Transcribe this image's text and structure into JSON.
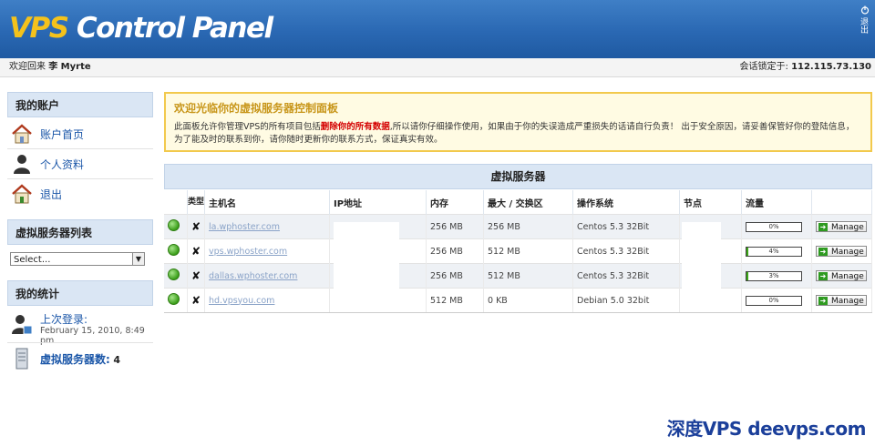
{
  "header": {
    "logo_vps": "VPS",
    "logo_rest": " Control Panel",
    "logout_icon": "power-icon",
    "logout_label": "退出"
  },
  "strip": {
    "welcome_prefix": "欢迎回来",
    "user_name": "李 Myrte",
    "session_label": "会话锁定于:",
    "session_ip": "112.115.73.130"
  },
  "sidebar": {
    "account_heading": "我的账户",
    "items": [
      {
        "label": "账户首页",
        "icon": "home-icon"
      },
      {
        "label": "个人资料",
        "icon": "user-icon"
      },
      {
        "label": "退出",
        "icon": "logout-house-icon"
      }
    ],
    "vs_list_heading": "虚拟服务器列表",
    "select_value": "Select...",
    "stats_heading": "我的统计",
    "last_login_label": "上次登录:",
    "last_login_value": "February 15, 2010, 8:49 pm",
    "vs_count_label": "虚拟服务器数:",
    "vs_count_value": "4"
  },
  "notice": {
    "title": "欢迎光临你的虚拟服务器控制面板",
    "body_before": "此面板允许你管理VPS的所有项目包括",
    "body_warn": "删除你的所有数据",
    "body_after": ",所以请你仔细操作使用，如果由于你的失误造成严重损失的话请自行负责！ 出于安全原因，请妥善保管好你的登陆信息，为了能及时的联系到你，请你随时更新你的联系方式，保证真实有效。"
  },
  "servers": {
    "title": "虚拟服务器",
    "columns": [
      "类型",
      "主机名",
      "IP地址",
      "内存",
      "最大 / 交换区",
      "操作系统",
      "节点",
      "流量"
    ],
    "rows": [
      {
        "host": "la.wphoster.com",
        "mem": "256 MB",
        "swap": "256 MB",
        "os": "Centos 5.3 32Bit",
        "traffic_pct": 0,
        "traffic_label": "0%",
        "action": "Manage"
      },
      {
        "host": "vps.wphoster.com",
        "mem": "256 MB",
        "swap": "512 MB",
        "os": "Centos 5.3 32Bit",
        "traffic_pct": 4,
        "traffic_label": "4%",
        "action": "Manage"
      },
      {
        "host": "dallas.wphoster.com",
        "mem": "256 MB",
        "swap": "512 MB",
        "os": "Centos 5.3 32Bit",
        "traffic_pct": 3,
        "traffic_label": "3%",
        "action": "Manage"
      },
      {
        "host": "hd.vpsyou.com",
        "mem": "512 MB",
        "swap": "0 KB",
        "os": "Debian 5.0 32bit",
        "traffic_pct": 0,
        "traffic_label": "0%",
        "action": "Manage"
      }
    ],
    "type_glyph": "✘",
    "status_color": "#3b9e1a"
  },
  "watermark": "深度VPS deevps.com"
}
